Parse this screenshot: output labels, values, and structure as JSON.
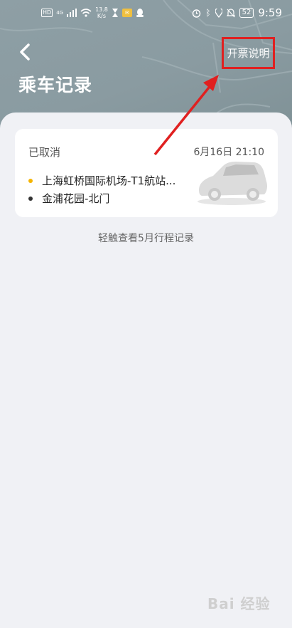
{
  "status_bar": {
    "network": "HD",
    "signal_label": "4G",
    "speed_value": "13.8",
    "speed_unit": "K/s",
    "battery": "52",
    "time": "9:59"
  },
  "header": {
    "back_icon": "chevron-left-icon",
    "invoice_label": "开票说明",
    "title": "乘车记录"
  },
  "trip": {
    "status": "已取消",
    "date": "6月16日 21:10",
    "from": "上海虹桥国际机场-T1航站...",
    "to": "金浦花园-北门",
    "from_dot_color": "#f5b400",
    "to_dot_color": "#333333"
  },
  "hint": "轻触查看5月行程记录",
  "watermark": "Bai 经验",
  "colors": {
    "annotation_red": "#e02020"
  }
}
